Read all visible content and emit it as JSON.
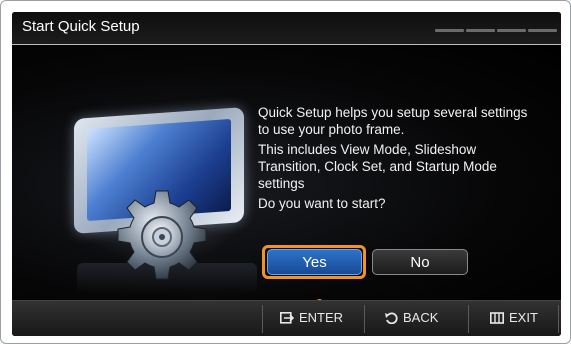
{
  "window": {
    "title": "Start Quick Setup"
  },
  "dialog": {
    "description": [
      "Quick Setup helps you setup several settings to use your photo frame.",
      "This includes View Mode, Slideshow Transition, Clock Set, and Startup Mode settings",
      "Do you want to start?"
    ],
    "buttons": {
      "yes_label": "Yes",
      "no_label": "No"
    },
    "focused_button": "Yes"
  },
  "footer": {
    "hints": [
      {
        "icon": "enter-icon",
        "label": "ENTER"
      },
      {
        "icon": "back-icon",
        "label": "BACK"
      },
      {
        "icon": "exit-icon",
        "label": "EXIT"
      }
    ]
  },
  "colors": {
    "highlight": "#f29323",
    "selected_button": "#2e72c9",
    "background": "#000000"
  }
}
